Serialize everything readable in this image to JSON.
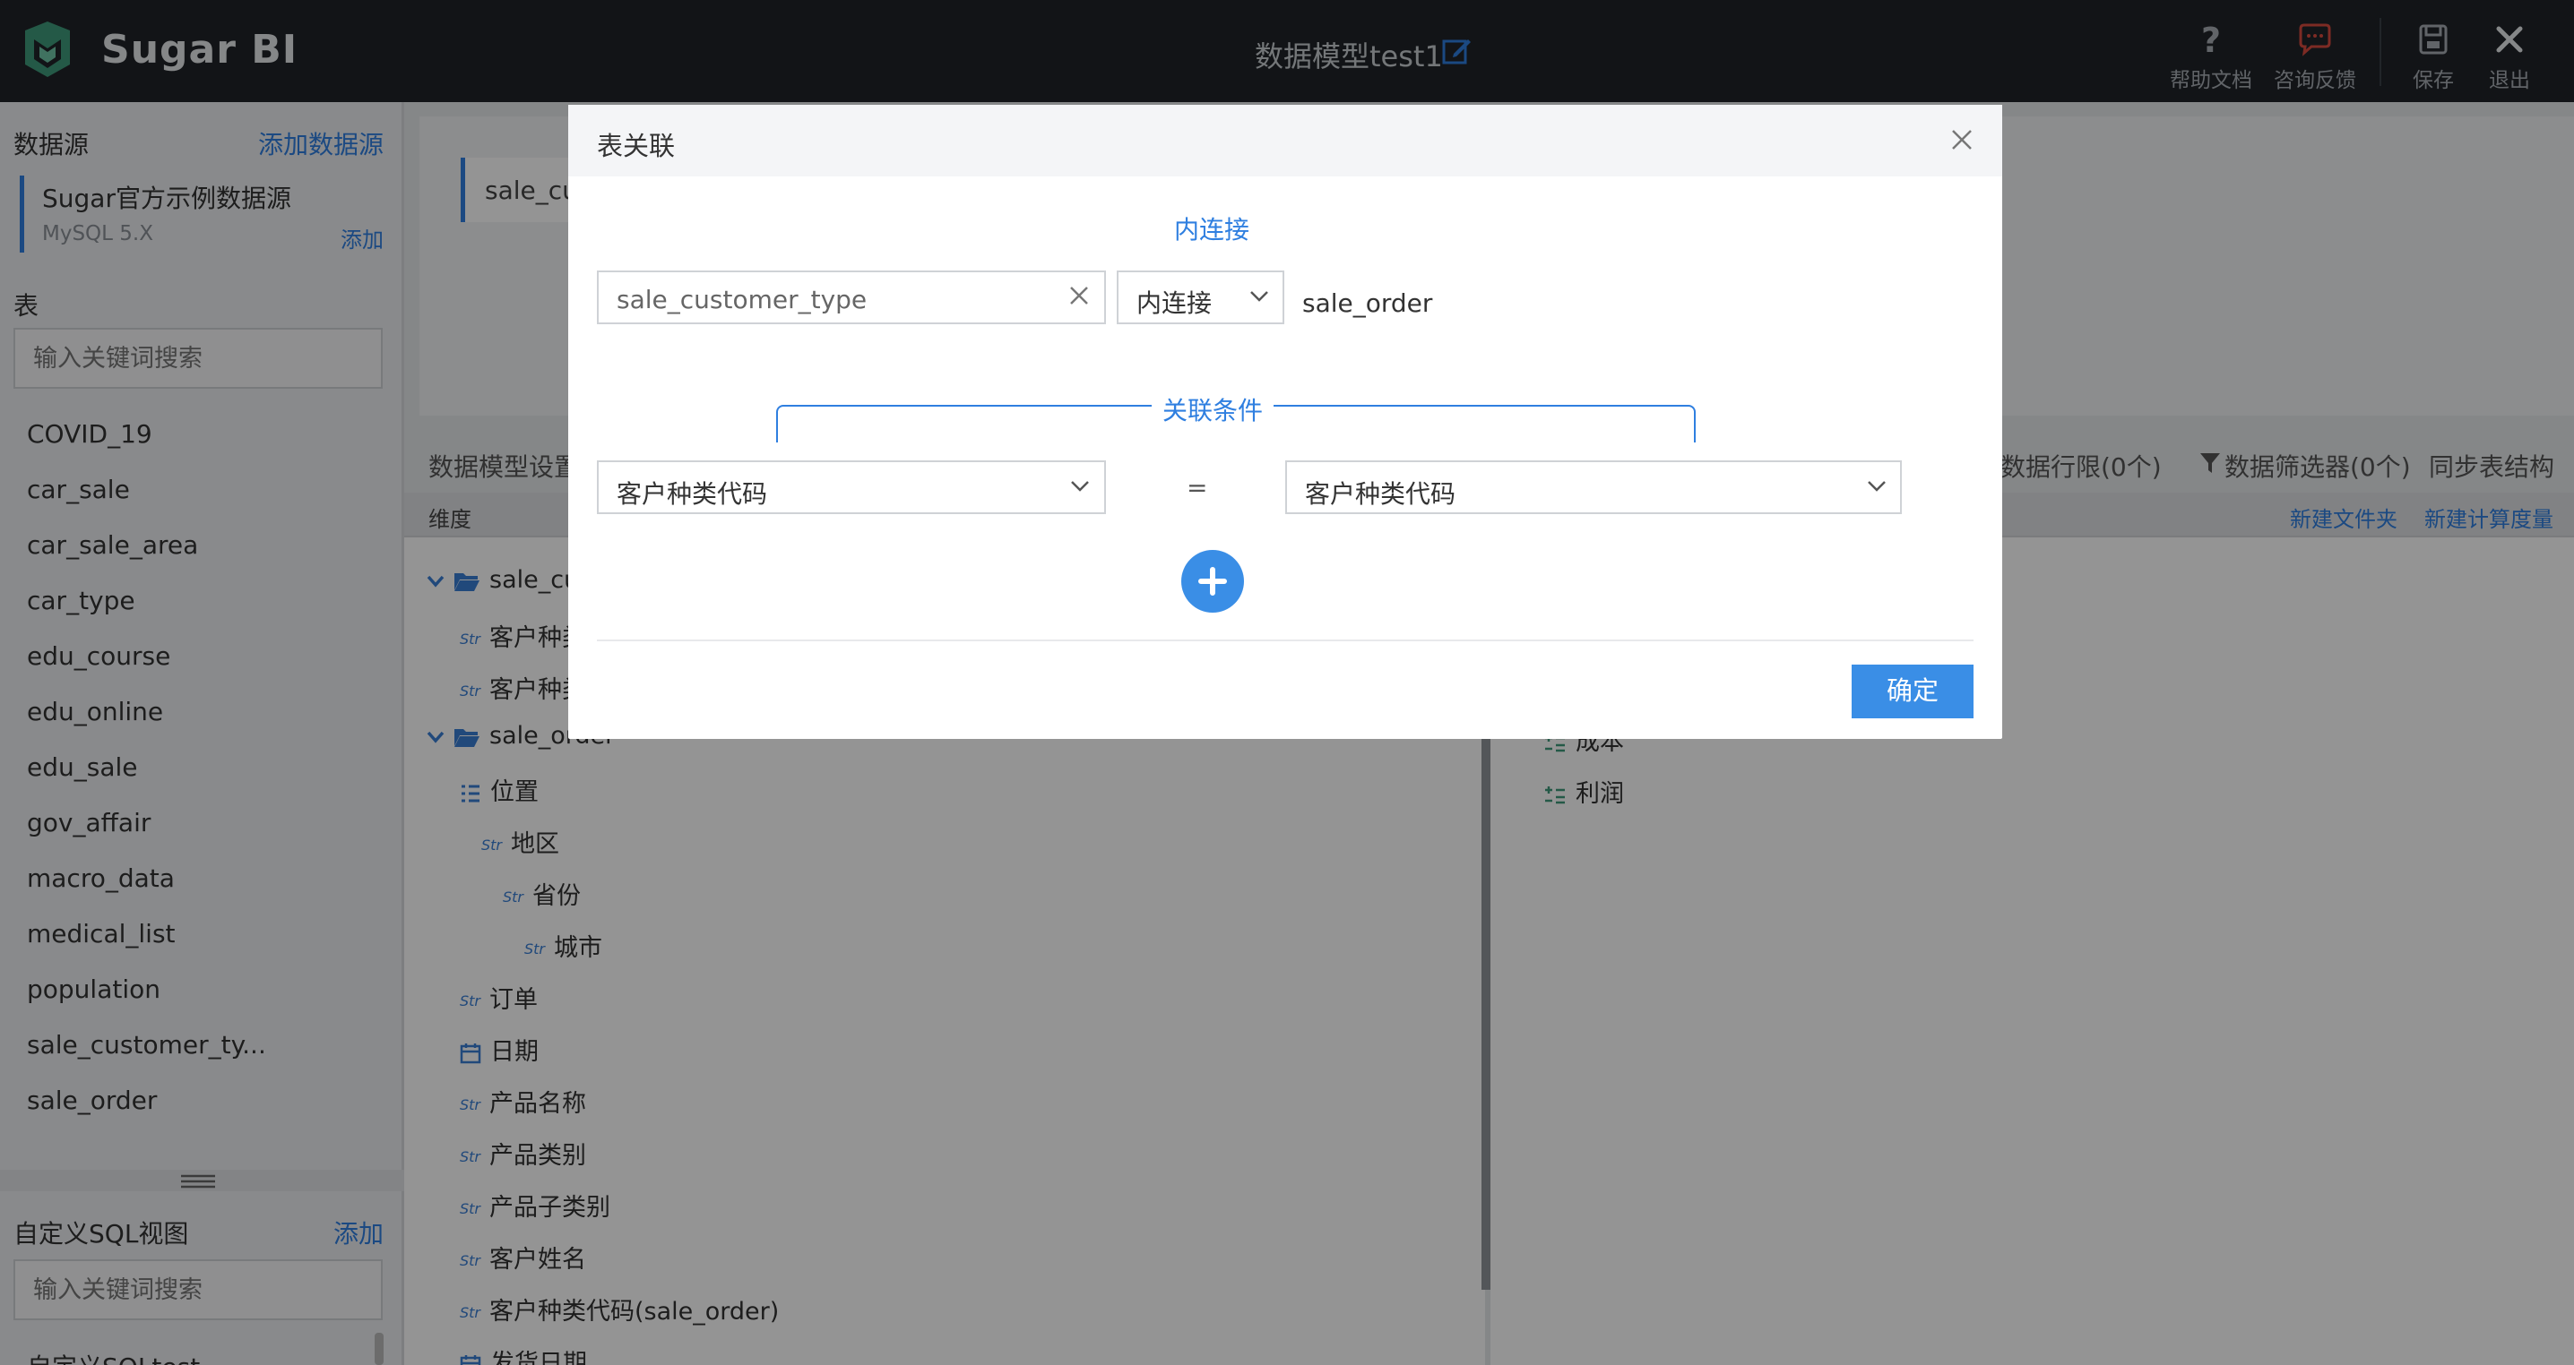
{
  "app": {
    "brand": "Sugar BI",
    "document_title": "数据模型test1"
  },
  "toolbar": {
    "help_label": "帮助文档",
    "feedback_label": "咨询反馈",
    "save_label": "保存",
    "exit_label": "退出"
  },
  "sidebar": {
    "datasource_heading": "数据源",
    "add_datasource_link": "添加数据源",
    "datasource": {
      "name": "Sugar官方示例数据源",
      "type": "MySQL 5.X",
      "add_label": "添加"
    },
    "tables_heading": "表",
    "table_search_placeholder": "输入关键词搜索",
    "tables": [
      "COVID_19",
      "car_sale",
      "car_sale_area",
      "car_type",
      "edu_course",
      "edu_online",
      "edu_sale",
      "gov_affair",
      "macro_data",
      "medical_list",
      "population",
      "sale_customer_ty...",
      "sale_order"
    ],
    "sql_view_heading": "自定义SQL视图",
    "sql_view_add": "添加",
    "sql_search_placeholder": "输入关键词搜索",
    "sql_views": [
      "自定义SQLtest"
    ]
  },
  "main": {
    "canvas_node": "sale_cu",
    "settings_title": "数据模型设置",
    "row_permission": "数据行限(0个)",
    "filter": "数据筛选器(0个)",
    "sync": "同步表结构",
    "dimension_label": "维度",
    "new_folder": "新建文件夹",
    "new_calc_measure": "新建计算度量",
    "tree": {
      "folder1": "sale_cu",
      "folder1_items": [
        "客户种类",
        "客户种类"
      ],
      "folder2": "sale_order",
      "hierarchy": "位置",
      "region": "地区",
      "province": "省份",
      "city": "城市",
      "items": [
        "订单",
        "日期",
        "产品名称",
        "产品类别",
        "产品子类别",
        "客户姓名",
        "客户种类代码(sale_order)",
        "发货日期"
      ],
      "str_tag": "Str"
    },
    "measures": [
      "成本",
      "利润"
    ]
  },
  "modal": {
    "title": "表关联",
    "join_type_label": "内连接",
    "left_table": "sale_customer_type",
    "join_select_value": "内连接",
    "right_table": "sale_order",
    "condition_label": "关联条件",
    "condition_left": "客户种类代码",
    "equals": "=",
    "condition_right": "客户种类代码",
    "confirm_label": "确定"
  },
  "colors": {
    "accent": "#3a8ee6",
    "topbar": "#1f2429",
    "link": "#2f7fe0",
    "feedback_icon": "#d84b3f"
  }
}
